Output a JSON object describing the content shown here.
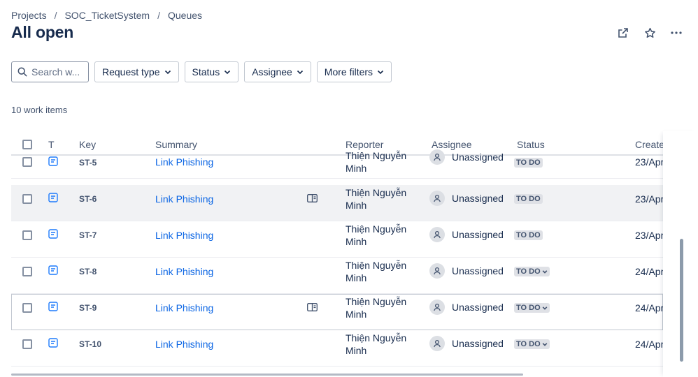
{
  "breadcrumb": {
    "projects": "Projects",
    "project": "SOC_TicketSystem",
    "section": "Queues",
    "separator": "/"
  },
  "page": {
    "title": "All open"
  },
  "filters": {
    "search_placeholder": "Search w...",
    "request_type": "Request type",
    "status": "Status",
    "assignee": "Assignee",
    "more": "More filters"
  },
  "count_text": "10 work items",
  "columns": {
    "type": "T",
    "key": "Key",
    "summary": "Summary",
    "reporter": "Reporter",
    "assignee": "Assignee",
    "status": "Status",
    "created": "Create"
  },
  "rows": [
    {
      "key": "ST-5",
      "summary": "Link Phishing",
      "reporter_line1": "Thiện Nguyễn",
      "reporter_line2": "Minh",
      "assignee": "Unassigned",
      "status": "TO DO",
      "created": "23/Apr"
    },
    {
      "key": "ST-6",
      "summary": "Link Phishing",
      "reporter_line1": "Thiện Nguyễn",
      "reporter_line2": "Minh",
      "assignee": "Unassigned",
      "status": "TO DO",
      "created": "23/Apr"
    },
    {
      "key": "ST-7",
      "summary": "Link Phishing",
      "reporter_line1": "Thiện Nguyễn",
      "reporter_line2": "Minh",
      "assignee": "Unassigned",
      "status": "TO DO",
      "created": "23/Apr"
    },
    {
      "key": "ST-8",
      "summary": "Link Phishing",
      "reporter_line1": "Thiện Nguyễn",
      "reporter_line2": "Minh",
      "assignee": "Unassigned",
      "status": "TO DO",
      "created": "24/Apr"
    },
    {
      "key": "ST-9",
      "summary": "Link Phishing",
      "reporter_line1": "Thiện Nguyễn",
      "reporter_line2": "Minh",
      "assignee": "Unassigned",
      "status": "TO DO",
      "created": "24/Apr"
    },
    {
      "key": "ST-10",
      "summary": "Link Phishing",
      "reporter_line1": "Thiện Nguyễn",
      "reporter_line2": "Minh",
      "assignee": "Unassigned",
      "status": "TO DO",
      "created": "24/Apr"
    }
  ],
  "colors": {
    "link": "#0c66e4",
    "row_highlight": "#f1f2f4",
    "text": "#172b4d",
    "lozenge": "#dfe1e6"
  }
}
